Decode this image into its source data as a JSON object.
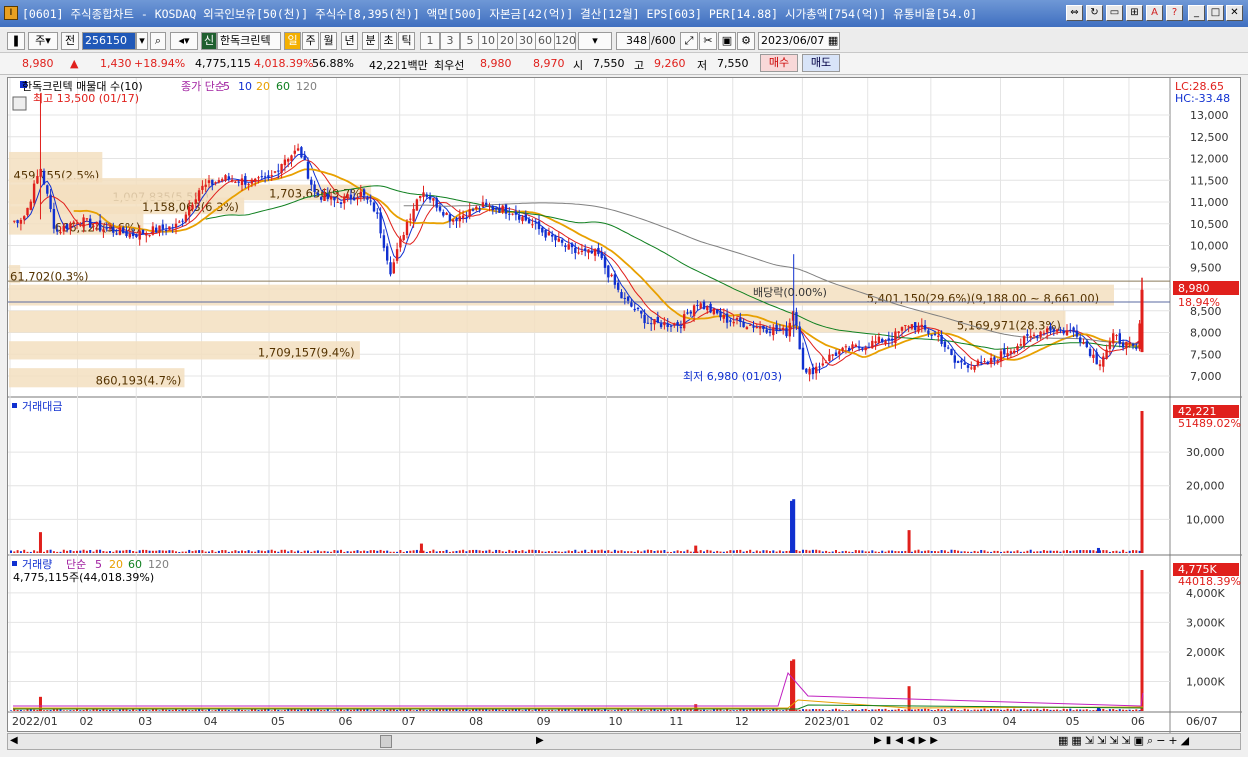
{
  "window": {
    "title": "[0601] 주식종합차트 - KOSDAQ 외국인보유[50(천)] 주식수[8,395(천)] 액면[500] 자본금[42(억)] 결산[12월] EPS[603] PER[14.88] 시가총액[754(억)] 유통비율[54.0]"
  },
  "toolbar": {
    "type_select": "주",
    "prev_label": "전",
    "code": "256150",
    "credit_badge": "신",
    "stock_name": "한독크린텍",
    "period_buttons": [
      "일",
      "주",
      "월",
      "년",
      "분",
      "초",
      "틱"
    ],
    "interval_buttons": [
      "1",
      "3",
      "5",
      "10",
      "20",
      "30",
      "60",
      "120"
    ],
    "count": "348",
    "count_total": "/600",
    "date": "2023/06/07"
  },
  "quote": {
    "price": "8,980",
    "arrow": "▲",
    "change": "1,430",
    "change_pct": "+18.94%",
    "volume": "4,775,115",
    "volume_pct": "4,018.39%",
    "turnover": "56.88%",
    "amount": "42,221백만",
    "best_bid_label": "최우선",
    "best_ask": "8,980",
    "best_bid": "8,970",
    "open_label": "시",
    "open": "7,550",
    "high_label": "고",
    "high": "9,260",
    "low_label": "저",
    "low": "7,550",
    "buy_label": "매수",
    "sell_label": "매도"
  },
  "price_panel": {
    "title": "한독크린텍 매물대 수(10)",
    "ma_label": "종가 단순",
    "ma_periods": [
      "5",
      "10",
      "20",
      "60",
      "120"
    ],
    "lc": "LC:28.65",
    "hc": "HC:-33.48",
    "current_tag": "8,980",
    "current_pct": "18.94%",
    "high_marker": "최고 13,500 (01/17)",
    "low_marker": "최저 6,980 (01/03)",
    "dividend_label": "배당락(0.00%)"
  },
  "amount_panel": {
    "title": "거래대금",
    "tag_value": "42,221",
    "tag_sub": "51489.02%"
  },
  "volume_panel": {
    "title": "거래량",
    "ma_label": "단순",
    "ma_periods": [
      "5",
      "20",
      "60",
      "120"
    ],
    "value_line": "4,775,115주(44,018.39%)",
    "tag_value": "4,775K",
    "tag_sub": "44018.39%"
  },
  "colors": {
    "up": "#e0201c",
    "down": "#1030d0",
    "ma5": "#1030d0",
    "ma10": "#e0201c",
    "ma20": "#e8a000",
    "ma60": "#108020",
    "ma120": "#808080",
    "profile": "#f3dfc0"
  },
  "chart_data": [
    {
      "type": "candlestick",
      "title": "한독크린텍 매물대 수(10)",
      "x_ticks": [
        "2022/01",
        "02",
        "03",
        "04",
        "05",
        "06",
        "07",
        "08",
        "09",
        "10",
        "11",
        "12",
        "2023/01",
        "02",
        "03",
        "04",
        "05",
        "06",
        "06/07"
      ],
      "y_ticks": [
        "13,000",
        "12,500",
        "12,000",
        "11,500",
        "11,000",
        "10,500",
        "10,000",
        "9,500",
        "9,000",
        "8,500",
        "8,000",
        "7,500",
        "7,000"
      ],
      "ylim": [
        6800,
        13500
      ],
      "close_path": [
        [
          "2022-01-03",
          10500
        ],
        [
          "2022-01-10",
          10700
        ],
        [
          "2022-01-17",
          11800
        ],
        [
          "2022-01-24",
          10300
        ],
        [
          "2022-02-03",
          10600
        ],
        [
          "2022-02-14",
          10400
        ],
        [
          "2022-02-28",
          10250
        ],
        [
          "2022-03-10",
          10350
        ],
        [
          "2022-03-21",
          10450
        ],
        [
          "2022-03-31",
          11300
        ],
        [
          "2022-04-11",
          11550
        ],
        [
          "2022-04-25",
          11450
        ],
        [
          "2022-05-02",
          11500
        ],
        [
          "2022-05-09",
          12000
        ],
        [
          "2022-05-16",
          12200
        ],
        [
          "2022-05-23",
          11200
        ],
        [
          "2022-06-02",
          11000
        ],
        [
          "2022-06-13",
          11200
        ],
        [
          "2022-06-20",
          10800
        ],
        [
          "2022-06-27",
          9400
        ],
        [
          "2022-07-04",
          10500
        ],
        [
          "2022-07-11",
          11300
        ],
        [
          "2022-07-25",
          10600
        ],
        [
          "2022-08-08",
          10900
        ],
        [
          "2022-08-22",
          10800
        ],
        [
          "2022-09-05",
          10300
        ],
        [
          "2022-09-19",
          9850
        ],
        [
          "2022-09-30",
          9800
        ],
        [
          "2022-10-11",
          8800
        ],
        [
          "2022-10-24",
          8200
        ],
        [
          "2022-11-07",
          8200
        ],
        [
          "2022-11-14",
          8700
        ],
        [
          "2022-11-28",
          8300
        ],
        [
          "2022-12-12",
          8150
        ],
        [
          "2022-12-26",
          8000
        ],
        [
          "2022-12-29",
          8600
        ],
        [
          "2023-01-03",
          7000
        ],
        [
          "2023-01-16",
          7500
        ],
        [
          "2023-01-30",
          7700
        ],
        [
          "2023-02-13",
          7900
        ],
        [
          "2023-02-20",
          8200
        ],
        [
          "2023-03-06",
          7900
        ],
        [
          "2023-03-13",
          7300
        ],
        [
          "2023-03-27",
          7250
        ],
        [
          "2023-04-10",
          7700
        ],
        [
          "2023-04-24",
          8100
        ],
        [
          "2023-05-08",
          8000
        ],
        [
          "2023-05-18",
          7300
        ],
        [
          "2023-05-25",
          7900
        ],
        [
          "2023-06-05",
          7550
        ],
        [
          "2023-06-07",
          8980
        ]
      ],
      "volume_profile": [
        {
          "label": "459,755(2.5%)",
          "pct": 2.5
        },
        {
          "label": "1,007,835(5.5%)",
          "pct": 5.5
        },
        {
          "label": "666,124(3.6%)",
          "pct": 3.6
        },
        {
          "label": "61,702(0.3%)",
          "pct": 0.3
        },
        {
          "label": "1,703,636(9.7%)",
          "pct": 9.7
        },
        {
          "label": "1,158,063(6.3%)",
          "pct": 6.3
        },
        {
          "label": "5,401,150(29.6%)(9,188.00 ~ 8,661.00)",
          "pct": 29.6
        },
        {
          "label": "5,169,971(28.3%)",
          "pct": 28.3
        },
        {
          "label": "1,709,157(9.4%)",
          "pct": 9.4
        },
        {
          "label": "860,193(4.7%)",
          "pct": 4.7
        }
      ]
    },
    {
      "type": "bar",
      "title": "거래대금",
      "y_ticks": [
        "30,000",
        "20,000",
        "10,000"
      ],
      "ylim": [
        0,
        42221
      ],
      "last_value": 42221
    },
    {
      "type": "bar",
      "title": "거래량",
      "y_ticks": [
        "4,000K",
        "3,000K",
        "2,000K",
        "1,000K"
      ],
      "ylim": [
        0,
        4775
      ],
      "last_value": 4775
    }
  ],
  "scroll_controls": [
    "▶",
    "▶▶",
    "■",
    "+",
    "−",
    "+",
    "▲"
  ]
}
